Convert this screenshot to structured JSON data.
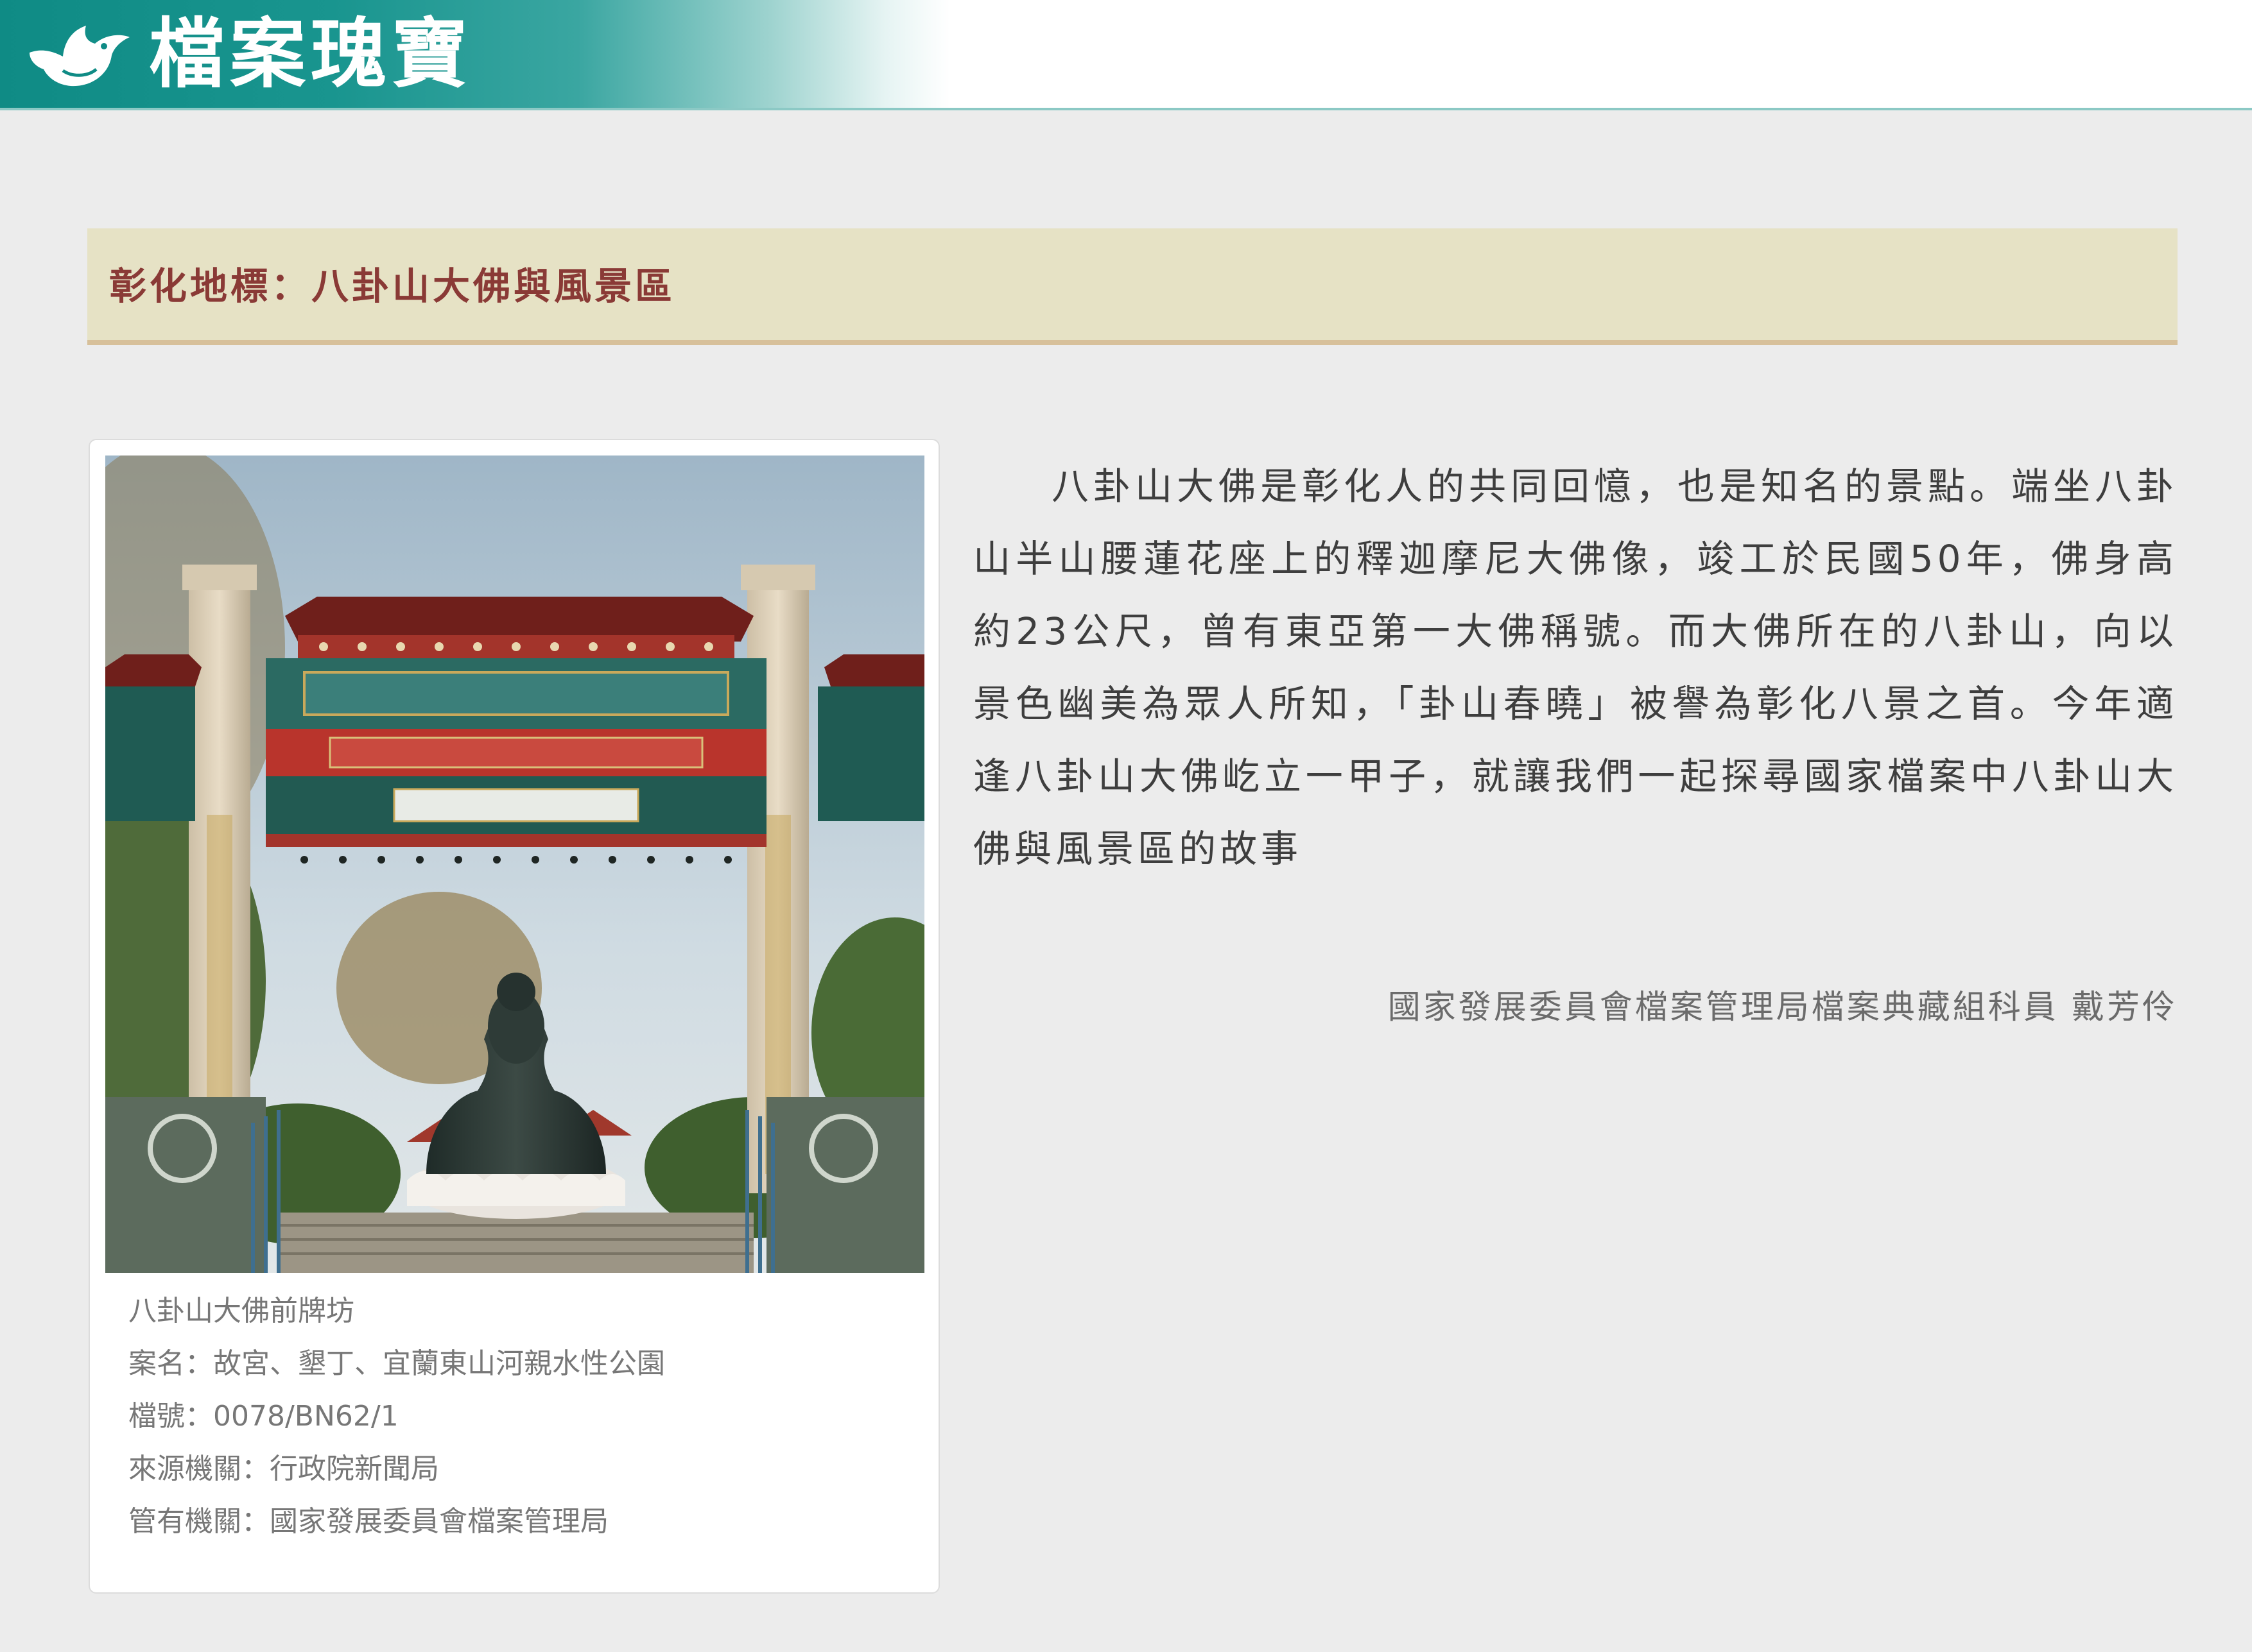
{
  "header": {
    "title": "檔案瑰寶",
    "logo_icon": "bird-logo-icon"
  },
  "section": {
    "title": "彰化地標：八卦山大佛與風景區"
  },
  "photo_card": {
    "image_icon": "bagua-mountain-buddha-gate-photo",
    "caption": "八卦山大佛前牌坊",
    "case_name": "案名：故宮、墾丁、宜蘭東山河親水性公園",
    "file_number": "檔號：0078/BN62/1",
    "source_agency": "來源機關：行政院新聞局",
    "custodian_agency": "管有機關：國家發展委員會檔案管理局"
  },
  "article": {
    "body": "八卦山大佛是彰化人的共同回憶，也是知名的景點。端坐八卦山半山腰蓮花座上的釋迦摩尼大佛像，竣工於民國50年，佛身高約23公尺，曾有東亞第一大佛稱號。而大佛所在的八卦山，向以景色幽美為眾人所知，「卦山春曉」被譽為彰化八景之首。今年適逢八卦山大佛屹立一甲子，就讓我們一起探尋國家檔案中八卦山大佛與風景區的故事",
    "author": "國家發展委員會檔案管理局檔案典藏組科員 戴芳伶"
  },
  "colors": {
    "header_teal": "#0f8b85",
    "section_bg": "#e6e2c5",
    "section_border": "#d7c09a",
    "section_title": "#8a3a36",
    "page_bg": "#ececec"
  }
}
